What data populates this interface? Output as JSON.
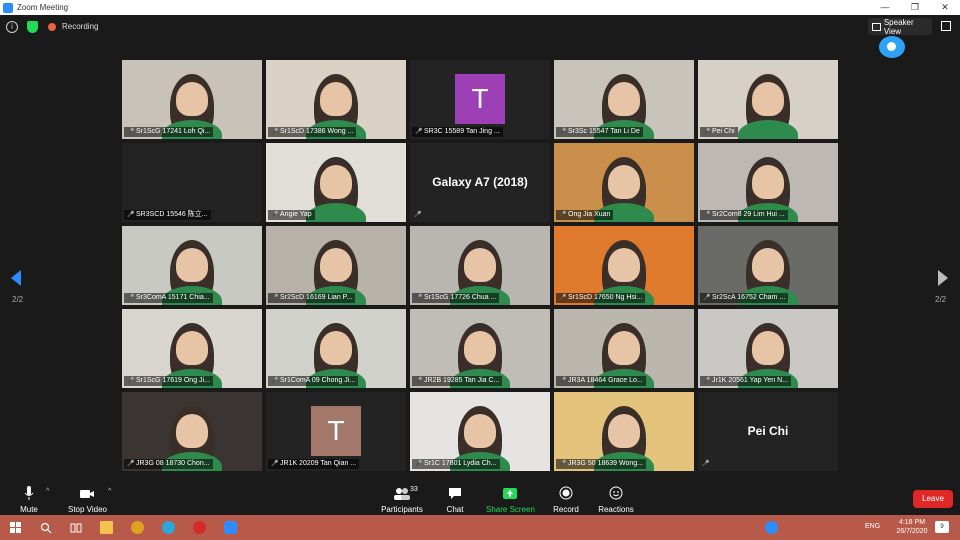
{
  "window": {
    "title": "Zoom Meeting",
    "controls": [
      "—",
      "❐",
      "✕"
    ]
  },
  "topbar": {
    "recording_label": "Recording",
    "speaker_view_label": "Speaker View"
  },
  "grid": {
    "page_left": "2/2",
    "page_right": "2/2",
    "tiles": [
      {
        "name": "Sr1ScG 17241 Loh Qi...",
        "kind": "video",
        "bg": "#c8c2b8"
      },
      {
        "name": "Sr1ScD 17386 Wong ...",
        "kind": "video",
        "bg": "#d9d2c5"
      },
      {
        "name": "SR3C 15589 Tan Jing ...",
        "kind": "letter",
        "letter": "T",
        "letter_bg": "#9d3fb5"
      },
      {
        "name": "Sr3Sc 15547 Tan Li De",
        "kind": "video",
        "bg": "#c9c4bb"
      },
      {
        "name": "Pei Chi",
        "kind": "video",
        "bg": "#d7d0c6"
      },
      {
        "name": "SR3SCD 15546 陈立...",
        "kind": "blank"
      },
      {
        "name": "Angie Yap",
        "kind": "video",
        "bg": "#e2dfd8"
      },
      {
        "name": "",
        "kind": "text",
        "text": "Galaxy A7 (2018)"
      },
      {
        "name": "Ong Jia Xuan",
        "kind": "video",
        "bg": "#c98f4b"
      },
      {
        "name": "Sr2Com8 29 Lim Hui ...",
        "kind": "video",
        "bg": "#bdb8b3"
      },
      {
        "name": "Sr3ComA 15171 Chia...",
        "kind": "video",
        "bg": "#c7c9c2"
      },
      {
        "name": "Sr2ScD 16169 Lian P...",
        "kind": "video",
        "bg": "#b9b2a8"
      },
      {
        "name": "Sr1ScG 17726 Chua ...",
        "kind": "video",
        "bg": "#b9b6b2"
      },
      {
        "name": "Sr1ScD 17650 Ng Hsi...",
        "kind": "video",
        "bg": "#e07a2d"
      },
      {
        "name": "Sr2ScA 16752 Cham ...",
        "kind": "video",
        "bg": "#6a6a66"
      },
      {
        "name": "Sr1ScG 17619 Ong Ji...",
        "kind": "video",
        "bg": "#d9d6d0"
      },
      {
        "name": "Sr1ComA 09 Chong Ji...",
        "kind": "video",
        "bg": "#d2d2cc"
      },
      {
        "name": "JR2B 19285 Tan Jia C...",
        "kind": "video",
        "bg": "#c0bdb6"
      },
      {
        "name": "JR3A 18464 Grace Lo...",
        "kind": "video",
        "bg": "#bcb7ae"
      },
      {
        "name": "Jr1K 20561 Yap Yen N...",
        "kind": "video",
        "bg": "#c9c8c4"
      },
      {
        "name": "JR3G 08 18730 Chon...",
        "kind": "video",
        "bg": "#3a3532"
      },
      {
        "name": "JR1K 20209 Tan Qian ...",
        "kind": "letter",
        "letter": "T",
        "letter_bg": "#a3776a"
      },
      {
        "name": "Sr1C 17801 Lydia Ch...",
        "kind": "video",
        "bg": "#e6e4e2"
      },
      {
        "name": "JR3G 50 18639 Wong...",
        "kind": "video",
        "bg": "#e4c37c"
      },
      {
        "name": "",
        "kind": "text",
        "text": "Pei Chi"
      }
    ]
  },
  "toolbar": {
    "mute": "Mute",
    "stop_video": "Stop Video",
    "participants": "Participants",
    "participants_count": "33",
    "chat": "Chat",
    "share_screen": "Share Screen",
    "record": "Record",
    "reactions": "Reactions",
    "leave": "Leave"
  },
  "taskbar": {
    "language": "ENG",
    "time": "4:18 PM",
    "date": "26/7/2020",
    "notification_count": "9"
  },
  "colors": {
    "accent": "#2d8cff",
    "share_green": "#23d959",
    "leave_red": "#e02828",
    "taskbar": "#b85a4a"
  }
}
